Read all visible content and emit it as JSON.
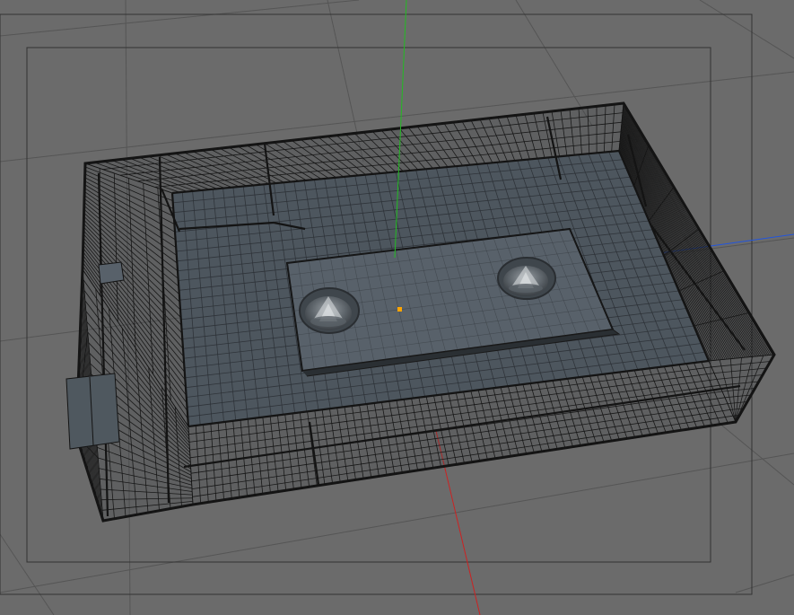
{
  "viewport": {
    "background_color": "#6b6b6b",
    "grid_line_color": "#555555",
    "safe_frame_color": "#333333",
    "axis_colors": {
      "x": "#cc2222",
      "y": "#22bb22",
      "z": "#2255dd"
    },
    "pivot_color": "#ffa500"
  },
  "model": {
    "wire_color": "#141414",
    "surface_color": "#4d565e",
    "panel_color": "#58616a",
    "grid_color": "#2c3136",
    "reel_icon": "cassette-reel-hub"
  }
}
